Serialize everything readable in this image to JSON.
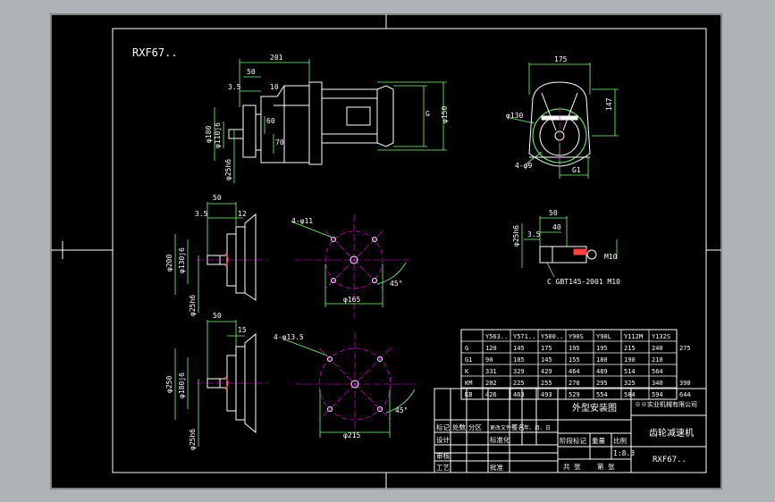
{
  "colors": {
    "background": "#000000",
    "frame": "#ffffff",
    "outline": "#ffffff",
    "dimension": "#7cfc7c",
    "center": "#ff00ff",
    "accent": "#ff4040",
    "table": "#ffffff",
    "label": "#ffffff"
  },
  "drawing": {
    "model_label": "RXF67..",
    "front_view": {
      "dims": {
        "d201": "201",
        "d50": "50",
        "d35": "3.5",
        "d10": "10",
        "d60": "60",
        "d70": "70",
        "d180": "φ180",
        "d110": "φ110j6",
        "d25": "φ25h6",
        "g": "G",
        "d150": "φ150"
      }
    },
    "side_view": {
      "dims": {
        "d175": "175",
        "d130": "φ130",
        "d147": "147",
        "holes": "4-φ9",
        "g1": "G1"
      }
    },
    "flange_small": {
      "dims": {
        "d50": "50",
        "d35": "3.5",
        "d12": "12",
        "d200": "φ200",
        "d130": "φ130j6",
        "d25": "φ25h6"
      }
    },
    "flange_small_face": {
      "dims": {
        "holes": "4-φ11",
        "d165": "φ165",
        "angle": "45°"
      }
    },
    "flange_large": {
      "dims": {
        "d50": "50",
        "d15": "15",
        "d250": "φ250",
        "d180": "φ180j6",
        "d25": "φ25h6"
      }
    },
    "flange_large_face": {
      "dims": {
        "holes": "4-φ13.5",
        "d215": "φ215",
        "angle": "45°"
      }
    },
    "shaft_detail": {
      "dims": {
        "d50": "50",
        "d40": "40",
        "d35": "3.5",
        "d25": "φ25h6",
        "m10": "M10",
        "note": "C GBT145-2001 M10"
      }
    }
  },
  "motor_table": {
    "headers": [
      "",
      "Y563..",
      "Y571..",
      "Y580..",
      "Y90S",
      "Y90L",
      "Y112M",
      "Y132S"
    ],
    "rows": [
      [
        "G",
        "120",
        "145",
        "175",
        "195",
        "195",
        "215",
        "240",
        "275"
      ],
      [
        "G1",
        "90",
        "105",
        "145",
        "155",
        "180",
        "190",
        "210"
      ],
      [
        "K",
        "331",
        "329",
        "429",
        "464",
        "489",
        "514",
        "564"
      ],
      [
        "KM",
        "202",
        "225",
        "255",
        "270",
        "295",
        "325",
        "340",
        "390"
      ],
      [
        "KB",
        "426",
        "463",
        "493",
        "529",
        "554",
        "584",
        "594",
        "644"
      ]
    ]
  },
  "title_block": {
    "drawing_title": "外型安装图",
    "company": "※※实业机械有限公司",
    "product": "齿轮减速机",
    "model": "RXF67..",
    "scale": "1:8.3",
    "labels": {
      "mark": "标记",
      "count": "处数",
      "zone": "分区",
      "doc_no": "更改文件号",
      "sign": "签名",
      "date": "年、月、日",
      "design": "设计",
      "standard": "标准化",
      "review": "审核",
      "process": "工艺",
      "approve": "批准",
      "stage_mark": "阶段标记",
      "weight": "重量",
      "ratio": "比例",
      "total": "共  张",
      "sheet": "第  张"
    }
  }
}
